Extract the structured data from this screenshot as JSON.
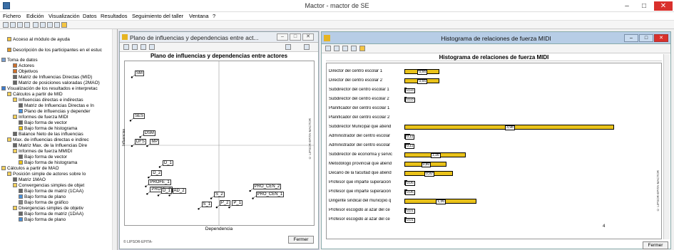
{
  "app": {
    "title": "Mactor  -  mactor de SE"
  },
  "window_controls": {
    "minimize": "–",
    "maximize": "□",
    "close": "✕"
  },
  "menu": [
    "Fichero",
    "Edición",
    "Visualización",
    "Datos",
    "Resultados",
    "Seguimiento del taller",
    "Ventana",
    "?"
  ],
  "sidebar": {
    "items": [
      {
        "label": "Acceso al módulo de ayuda",
        "indent": 1,
        "icon": "help-icon"
      },
      {
        "label": "Descripción de los participantes en el estuc",
        "indent": 1,
        "icon": "people-icon"
      },
      {
        "label": "Toma de datos",
        "indent": 0,
        "icon": "data-icon"
      },
      {
        "label": "Actores",
        "indent": 2,
        "icon": "actor-icon"
      },
      {
        "label": "Objetivos",
        "indent": 2,
        "icon": "objective-icon"
      },
      {
        "label": "Matriz de Influencias Directas (MID)",
        "indent": 2,
        "icon": "matrix-icon"
      },
      {
        "label": "Matriz de posiciones valoradas (2MAO)",
        "indent": 2,
        "icon": "matrix-icon"
      },
      {
        "label": "Visualización de los resultados e interpretac",
        "indent": 0,
        "icon": "chart-icon"
      },
      {
        "label": "Cálculos a partir de MID",
        "indent": 1,
        "icon": "folder-icon"
      },
      {
        "label": "Influencias directas e indirectas",
        "indent": 2,
        "icon": "folder-icon"
      },
      {
        "label": "Matriz de Influencias Directas e In",
        "indent": 3,
        "icon": "matrix-icon"
      },
      {
        "label": "Plano de influencias y depender",
        "indent": 3,
        "icon": "plane-icon"
      },
      {
        "label": "Informes de fuerza MIDI",
        "indent": 2,
        "icon": "folder-icon"
      },
      {
        "label": "Bajo forma de vector",
        "indent": 3,
        "icon": "matrix-icon"
      },
      {
        "label": "Bajo forma de histograma",
        "indent": 3,
        "icon": "histogram-icon"
      },
      {
        "label": "Balance Neto de las influencias",
        "indent": 2,
        "icon": "matrix-icon"
      },
      {
        "label": "Max. de influencias directas e indirec",
        "indent": 1,
        "icon": "folder-icon"
      },
      {
        "label": "Matriz Max. de la Influencias Dire",
        "indent": 2,
        "icon": "matrix-icon"
      },
      {
        "label": "Informes de fuerza MMIDI",
        "indent": 2,
        "icon": "folder-icon"
      },
      {
        "label": "Bajo forma de vector",
        "indent": 3,
        "icon": "matrix-icon"
      },
      {
        "label": "Bajo forma de histograma",
        "indent": 3,
        "icon": "histogram-icon"
      },
      {
        "label": "Cálculos a partir de MAO",
        "indent": 0,
        "icon": "folder-icon"
      },
      {
        "label": "Posición simple de actores sobre lo",
        "indent": 1,
        "icon": "folder-icon"
      },
      {
        "label": "Matriz 1MAO",
        "indent": 2,
        "icon": "matrix-icon"
      },
      {
        "label": "Convergencias simples de objet",
        "indent": 2,
        "icon": "folder-icon"
      },
      {
        "label": "Bajo forma de matriz (1CAA)",
        "indent": 3,
        "icon": "matrix-icon"
      },
      {
        "label": "Bajo forma de plano",
        "indent": 3,
        "icon": "plane-icon"
      },
      {
        "label": "Bajo forma de gráfico",
        "indent": 3,
        "icon": "graph-icon"
      },
      {
        "label": "Divergencias simples de objetiv",
        "indent": 2,
        "icon": "folder-icon"
      },
      {
        "label": "Bajo forma de matriz (1DAA)",
        "indent": 3,
        "icon": "matrix-icon"
      },
      {
        "label": "Bajo forma de plano",
        "indent": 3,
        "icon": "plane-icon"
      }
    ]
  },
  "plane_window": {
    "title": "Plano de influencias y dependencias entre act...",
    "plot_title": "Plano de influencias y dependencias entre actores",
    "x_label": "Dependencia",
    "y_label": "Influencias",
    "watermark": "© LIPSOR-EPITA-MACTOR",
    "close_label": "Fermer",
    "footer": "© LIPSOR-EPITA-",
    "chart_data": {
      "type": "scatter",
      "points": [
        {
          "label": "SM",
          "x": 0.02,
          "y": 0.95
        },
        {
          "label": "SES",
          "x": 0.01,
          "y": 0.66
        },
        {
          "label": "DSM",
          "x": 0.08,
          "y": 0.55
        },
        {
          "label": "DFS",
          "x": 0.02,
          "y": 0.49
        },
        {
          "label": "MP",
          "x": 0.13,
          "y": 0.49
        },
        {
          "label": "D_1",
          "x": 0.22,
          "y": 0.35
        },
        {
          "label": "D_2",
          "x": 0.14,
          "y": 0.28
        },
        {
          "label": "PROFE_1",
          "x": 0.12,
          "y": 0.22
        },
        {
          "label": "PROFE_2",
          "x": 0.13,
          "y": 0.17
        },
        {
          "label": "D_1",
          "x": 0.21,
          "y": 0.16
        },
        {
          "label": "AD_2",
          "x": 0.29,
          "y": 0.16
        },
        {
          "label": "S_2",
          "x": 0.59,
          "y": 0.14
        },
        {
          "label": "S_1",
          "x": 0.5,
          "y": 0.07
        },
        {
          "label": "P_2",
          "x": 0.63,
          "y": 0.08
        },
        {
          "label": "P_1",
          "x": 0.72,
          "y": 0.08
        },
        {
          "label": "PRO_CEN_2",
          "x": 0.87,
          "y": 0.19
        },
        {
          "label": "PRO_CEN_1",
          "x": 0.89,
          "y": 0.14
        }
      ]
    }
  },
  "hist_window": {
    "title": "Histograma de relaciones de fuerza MIDI",
    "hist_title": "Histograma de relaciones de fuerza MIDI",
    "close_label": "Fermer",
    "axis_tick": "4",
    "watermark": "© LIPSOR-EPITA-MACTOR",
    "chart_data": {
      "type": "bar",
      "orientation": "horizontal",
      "categories": [
        "Director del centro escolar 1",
        "Director del centro escolar 2",
        "Subdirector del centro escolar 1",
        "Subdirector del centro escolar 2",
        "Planificador del centro escolar 1",
        "Planificador del centro escolar 2",
        "Subdirector Municipal que atiend",
        "Administrador del centro escolar",
        "Administrador del centro escolar",
        "Subdirector de economía y servic",
        "Metodólogo provincial que atiend",
        "Decano de la facultad que atiend",
        "Profesor que imparte superación",
        "Profesor que imparte superación",
        "Dirigente sindical del municipio q",
        "Profesor escogido al azar del ce",
        "Profesor escogido al azar del ce"
      ],
      "values": [
        0.66,
        0.66,
        0.03,
        0.03,
        0,
        0,
        3.98,
        0.11,
        0.11,
        1.16,
        0.8,
        0.92,
        0.06,
        0.06,
        1.36,
        0.01,
        0.01
      ],
      "value_labels": [
        "0,66",
        "0,66",
        "0,03",
        "0,03",
        "",
        "",
        "3,98",
        "0,11",
        "0,11",
        "1,16",
        "0,80",
        "0,92",
        "0,06",
        "0,06",
        "1,36",
        "0,01",
        "0,01"
      ],
      "xlim": [
        0,
        4.6
      ],
      "bar_color": "#e9c21a"
    }
  }
}
